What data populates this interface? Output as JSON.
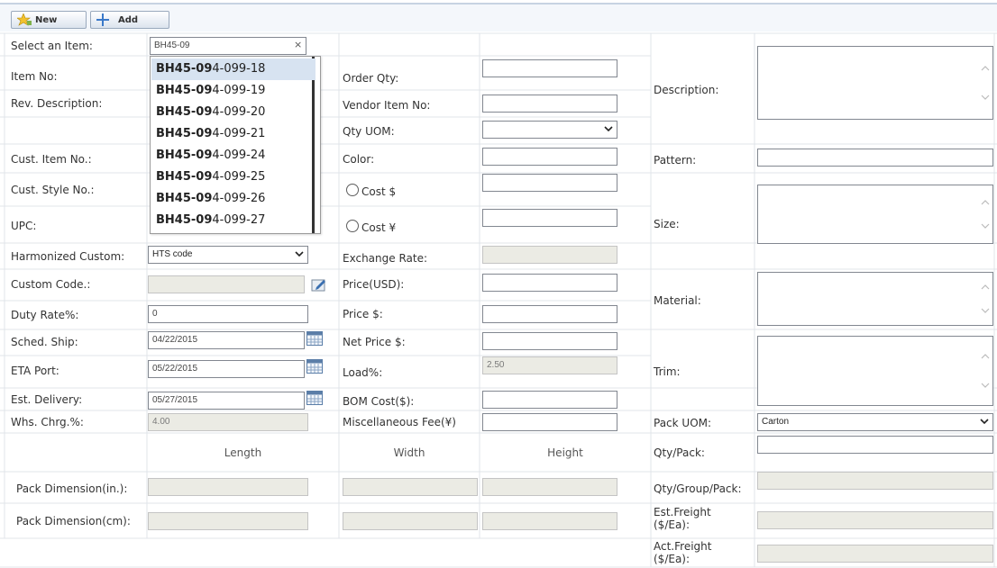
{
  "toolbar": {
    "new_label": "New",
    "add_label": "Add"
  },
  "select_item": {
    "label": "Select an Item:",
    "value": "BH45-09",
    "clear": "×"
  },
  "autocomplete": {
    "typed": "BH45-09",
    "items": [
      {
        "match": "BH45-09",
        "rest": "4-099-18"
      },
      {
        "match": "BH45-09",
        "rest": "4-099-19"
      },
      {
        "match": "BH45-09",
        "rest": "4-099-20"
      },
      {
        "match": "BH45-09",
        "rest": "4-099-21"
      },
      {
        "match": "BH45-09",
        "rest": "4-099-24"
      },
      {
        "match": "BH45-09",
        "rest": "4-099-25"
      },
      {
        "match": "BH45-09",
        "rest": "4-099-26"
      },
      {
        "match": "BH45-09",
        "rest": "4-099-27"
      }
    ]
  },
  "left": {
    "item_no": "Item No:",
    "rev_description": "Rev. Description:",
    "cust_item_no": "Cust. Item No.:",
    "cust_style_no": "Cust. Style No.:",
    "upc": "UPC:",
    "harmonized_custom": "Harmonized Custom:",
    "harmonized_value": "HTS code",
    "custom_code": "Custom Code.:",
    "duty_rate": "Duty Rate%:",
    "duty_rate_value": "0",
    "sched_ship": "Sched. Ship:",
    "sched_ship_value": "04/22/2015",
    "eta_port": "ETA Port:",
    "eta_port_value": "05/22/2015",
    "est_delivery": "Est. Delivery:",
    "est_delivery_value": "05/27/2015",
    "whs_chrg": "Whs. Chrg.%:",
    "whs_chrg_value": "4.00"
  },
  "middle": {
    "order_qty": "Order Qty:",
    "vendor_item_no": "Vendor Item No:",
    "qty_uom": "Qty UOM:",
    "color": "Color:",
    "cost_usd": "Cost $",
    "cost_cny": "Cost ¥",
    "exchange_rate": "Exchange Rate:",
    "price_usd": "Price(USD):",
    "price": "Price $:",
    "net_price": "Net Price $:",
    "load": "Load%:",
    "load_value": "2.50",
    "bom_cost": "BOM Cost($):",
    "misc_fee": "Miscellaneous Fee(¥)"
  },
  "right": {
    "description": "Description:",
    "pattern": "Pattern:",
    "size": "Size:",
    "material": "Material:",
    "trim": "Trim:",
    "pack_uom": "Pack UOM:",
    "pack_uom_value": "Carton",
    "qty_pack": "Qty/Pack:",
    "qty_group_pack": "Qty/Group/Pack:",
    "est_freight": "Est.Freight",
    "est_freight_unit": "($/Ea):",
    "act_freight": "Act.Freight",
    "act_freight_unit": "($/Ea):"
  },
  "dimensions": {
    "length": "Length",
    "width": "Width",
    "height": "Height",
    "pack_dim_in": "Pack Dimension(in.):",
    "pack_dim_cm": "Pack Dimension(cm):"
  },
  "colors": {
    "accent_blue": "#2d6fc3",
    "border": "#e1e4ea",
    "disabled": "#ebebe4",
    "highlight": "#d7e3f1"
  }
}
